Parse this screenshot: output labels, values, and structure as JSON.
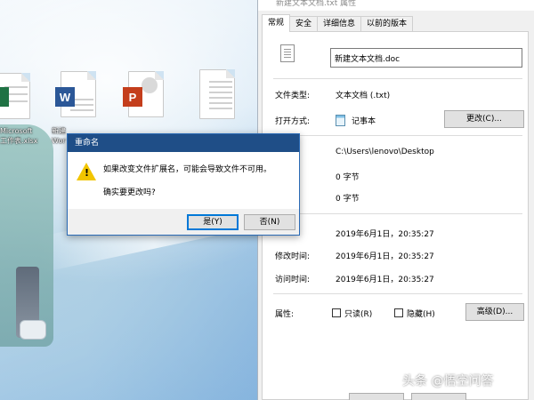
{
  "desktop": {
    "icons": [
      {
        "type": "excel",
        "label_lines": [
          "Microsoft",
          "工作表.xlsx"
        ],
        "color": "#1f7244"
      },
      {
        "type": "word",
        "label_lines": [
          "新建",
          "Wor"
        ],
        "color": "#2b5797",
        "badge": "W"
      },
      {
        "type": "powerpoint",
        "label_lines": [
          "",
          ""
        ],
        "color": "#c43e1c",
        "badge": "P"
      },
      {
        "type": "text",
        "label_lines": [
          "",
          ""
        ]
      }
    ]
  },
  "properties": {
    "title": "新建文本文档.txt 属性",
    "tabs": [
      "常规",
      "安全",
      "详细信息",
      "以前的版本"
    ],
    "active_tab": "常规",
    "filename_value": "新建文本文档.doc",
    "rows": {
      "type_label": "文件类型:",
      "type_value": "文本文档 (.txt)",
      "open_with_label": "打开方式:",
      "open_with_value": "记事本",
      "change_button": "更改(C)...",
      "location_value": "C:\\Users\\lenovo\\Desktop",
      "size_value": "0 字节",
      "size_on_disk_value": "0 字节",
      "created_value": "2019年6月1日，20:35:27",
      "modified_label": "修改时间:",
      "modified_value": "2019年6月1日，20:35:27",
      "accessed_label": "访问时间:",
      "accessed_value": "2019年6月1日，20:35:27",
      "attributes_label": "属性:",
      "readonly_label": "只读(R)",
      "hidden_label": "隐藏(H)",
      "advanced_button": "高级(D)..."
    }
  },
  "dialog": {
    "title": "重命名",
    "message": "如果改变文件扩展名，可能会导致文件不可用。",
    "confirm": "确实要更改吗?",
    "yes_button": "是(Y)",
    "no_button": "否(N)"
  },
  "watermark": "头条 @悟空问答",
  "colors": {
    "dialog_title_bg": "#1f4e87",
    "warning": "#f2c500",
    "accent": "#0078d7"
  }
}
